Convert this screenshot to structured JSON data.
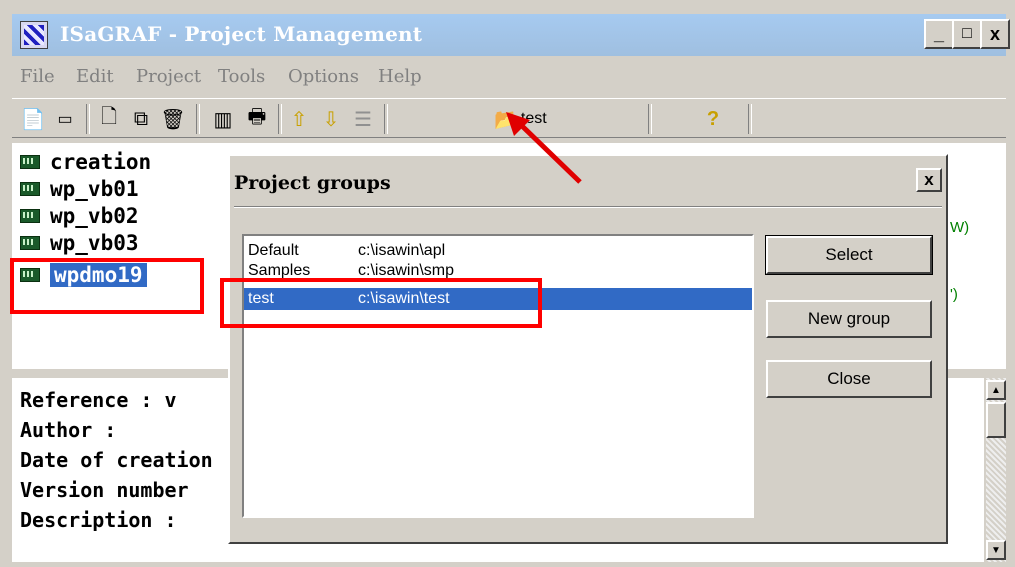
{
  "window": {
    "title": "ISaGRAF - Project Management",
    "controls": {
      "minimize": "_",
      "maximize": "□",
      "close": "x"
    }
  },
  "menu": [
    "File",
    "Edit",
    "Project",
    "Tools",
    "Options",
    "Help"
  ],
  "toolbar": {
    "group_button_label": "test",
    "help_glyph": "?"
  },
  "projects": [
    {
      "name": "creation",
      "selected": false
    },
    {
      "name": "wp_vb01",
      "selected": false
    },
    {
      "name": "wp_vb02",
      "selected": false
    },
    {
      "name": "wp_vb03",
      "selected": false
    },
    {
      "name": "wpdmo19",
      "selected": true
    }
  ],
  "project_fragments": [
    "W)",
    "')"
  ],
  "properties": {
    "reference": "Reference      : v",
    "author": "Author         :",
    "date": "Date of creation :",
    "version": "Version number",
    "description": "Description      :"
  },
  "dialog": {
    "title": "Project groups",
    "close": "x",
    "groups": [
      {
        "name": "Default",
        "path": "c:\\isawin\\apl",
        "selected": false
      },
      {
        "name": "Samples",
        "path": "c:\\isawin\\smp",
        "selected": false
      },
      {
        "name": "test",
        "path": "c:\\isawin\\test",
        "selected": true
      }
    ],
    "buttons": {
      "select": "Select",
      "new_group": "New group",
      "close": "Close"
    }
  },
  "colors": {
    "selection": "#316ac5",
    "highlight": "#ff0000",
    "face": "#d4d0c8",
    "title_bar": "#a6caf0"
  }
}
